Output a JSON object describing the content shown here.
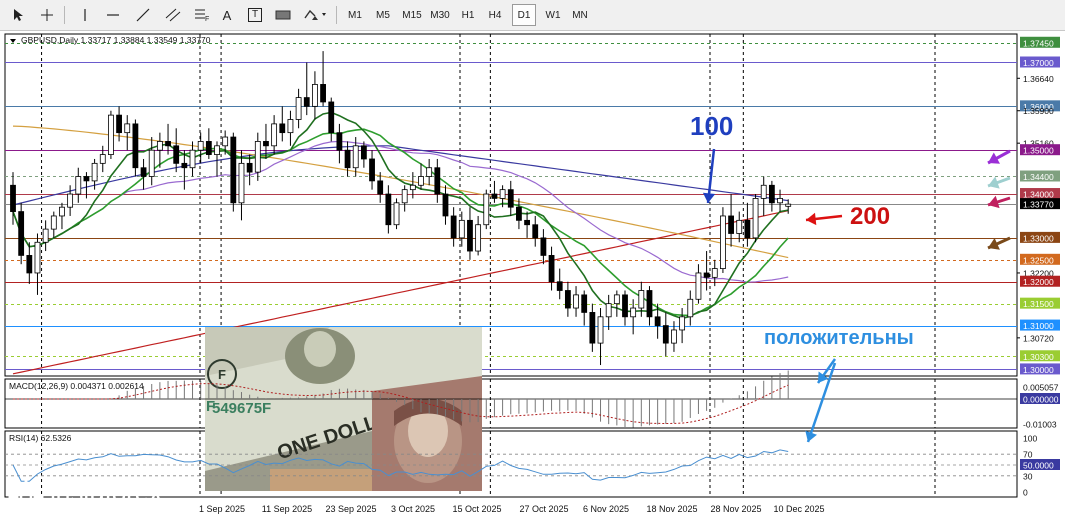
{
  "toolbar": {
    "timeframes": [
      "M1",
      "M5",
      "M15",
      "M30",
      "H1",
      "H4",
      "D1",
      "W1",
      "MN"
    ],
    "active_timeframe": "D1",
    "text_tool": "A",
    "label_tool": "T"
  },
  "chart_data": {
    "type": "candlestick",
    "symbol_header": "GBPUSD,Daily",
    "ohlc_header": "1.33717 1.33884 1.33549 1.33770",
    "price_axis": {
      "labels": [
        "1.37450",
        "1.37000",
        "1.36640",
        "1.36000",
        "1.35900",
        "1.35160",
        "1.35000",
        "1.34400",
        "1.34000",
        "1.33770",
        "1.33000",
        "1.32500",
        "1.32200",
        "1.32000",
        "1.31500",
        "1.31000",
        "1.30720",
        "1.30300",
        "1.30000"
      ],
      "range": [
        1.2985,
        1.3765
      ]
    },
    "horizontal_levels": [
      {
        "price": 1.3745,
        "label": "1.37450",
        "color": "#3f8f3f",
        "dashed": true
      },
      {
        "price": 1.37,
        "label": "1.37000",
        "color": "#6a5acd",
        "dashed": false
      },
      {
        "price": 1.36,
        "label": "1.36000",
        "color": "#4a7aa8",
        "dashed": false
      },
      {
        "price": 1.35,
        "label": "1.35000",
        "color": "#8b1a8b",
        "dashed": false
      },
      {
        "price": 1.344,
        "label": "1.34400",
        "color": "#7fa07f",
        "dashed": true
      },
      {
        "price": 1.34,
        "label": "1.34000",
        "color": "#b03a4a",
        "dashed": false
      },
      {
        "price": 1.3377,
        "label": "1.33770",
        "color": "#888888",
        "dashed": false,
        "current": true
      },
      {
        "price": 1.33,
        "label": "1.33000",
        "color": "#8b4513",
        "dashed": false
      },
      {
        "price": 1.325,
        "label": "1.32500",
        "color": "#d2691e",
        "dashed": true
      },
      {
        "price": 1.32,
        "label": "1.32000",
        "color": "#b22222",
        "dashed": false
      },
      {
        "price": 1.315,
        "label": "1.31500",
        "color": "#9acd32",
        "dashed": true
      },
      {
        "price": 1.31,
        "label": "1.31000",
        "color": "#1e90ff",
        "dashed": false
      },
      {
        "price": 1.303,
        "label": "1.30300",
        "color": "#9acd32",
        "dashed": true
      },
      {
        "price": 1.3,
        "label": "1.30000",
        "color": "#6a5acd",
        "dashed": false
      }
    ],
    "x_axis_labels": [
      "1 Sep 2025",
      "11 Sep 2025",
      "23 Sep 2025",
      "3 Oct 2025",
      "15 Oct 2025",
      "27 Oct 2025",
      "6 Nov 2025",
      "18 Nov 2025",
      "28 Nov 2025",
      "10 Dec 2025"
    ],
    "candles": [
      [
        1.342,
        1.345,
        1.333,
        1.336
      ],
      [
        1.336,
        1.338,
        1.324,
        1.326
      ],
      [
        1.326,
        1.329,
        1.3195,
        1.322
      ],
      [
        1.322,
        1.331,
        1.317,
        1.329
      ],
      [
        1.329,
        1.334,
        1.327,
        1.332
      ],
      [
        1.332,
        1.336,
        1.33,
        1.335
      ],
      [
        1.335,
        1.338,
        1.332,
        1.337
      ],
      [
        1.337,
        1.342,
        1.335,
        1.34
      ],
      [
        1.34,
        1.346,
        1.338,
        1.344
      ],
      [
        1.344,
        1.345,
        1.339,
        1.343
      ],
      [
        1.343,
        1.348,
        1.341,
        1.347
      ],
      [
        1.347,
        1.351,
        1.345,
        1.349
      ],
      [
        1.349,
        1.359,
        1.348,
        1.358
      ],
      [
        1.358,
        1.36,
        1.352,
        1.354
      ],
      [
        1.354,
        1.358,
        1.35,
        1.356
      ],
      [
        1.356,
        1.357,
        1.344,
        1.346
      ],
      [
        1.346,
        1.348,
        1.341,
        1.344
      ],
      [
        1.344,
        1.353,
        1.342,
        1.35
      ],
      [
        1.35,
        1.354,
        1.346,
        1.352
      ],
      [
        1.352,
        1.356,
        1.349,
        1.351
      ],
      [
        1.351,
        1.355,
        1.345,
        1.347
      ],
      [
        1.347,
        1.35,
        1.341,
        1.346
      ],
      [
        1.346,
        1.352,
        1.344,
        1.35
      ],
      [
        1.35,
        1.354,
        1.347,
        1.352
      ],
      [
        1.352,
        1.355,
        1.348,
        1.349
      ],
      [
        1.349,
        1.352,
        1.344,
        1.351
      ],
      [
        1.351,
        1.3545,
        1.349,
        1.353
      ],
      [
        1.353,
        1.354,
        1.336,
        1.338
      ],
      [
        1.338,
        1.35,
        1.334,
        1.347
      ],
      [
        1.347,
        1.349,
        1.342,
        1.345
      ],
      [
        1.345,
        1.354,
        1.343,
        1.352
      ],
      [
        1.352,
        1.356,
        1.348,
        1.351
      ],
      [
        1.351,
        1.358,
        1.349,
        1.356
      ],
      [
        1.356,
        1.36,
        1.352,
        1.354
      ],
      [
        1.354,
        1.359,
        1.351,
        1.357
      ],
      [
        1.357,
        1.364,
        1.355,
        1.362
      ],
      [
        1.362,
        1.37,
        1.358,
        1.36
      ],
      [
        1.36,
        1.368,
        1.357,
        1.365
      ],
      [
        1.365,
        1.3726,
        1.36,
        1.361
      ],
      [
        1.361,
        1.362,
        1.352,
        1.354
      ],
      [
        1.354,
        1.356,
        1.347,
        1.35
      ],
      [
        1.35,
        1.352,
        1.344,
        1.346
      ],
      [
        1.346,
        1.353,
        1.344,
        1.351
      ],
      [
        1.351,
        1.352,
        1.346,
        1.348
      ],
      [
        1.348,
        1.35,
        1.341,
        1.343
      ],
      [
        1.343,
        1.345,
        1.338,
        1.34
      ],
      [
        1.34,
        1.342,
        1.331,
        1.333
      ],
      [
        1.333,
        1.339,
        1.332,
        1.338
      ],
      [
        1.338,
        1.342,
        1.336,
        1.341
      ],
      [
        1.341,
        1.345,
        1.339,
        1.342
      ],
      [
        1.342,
        1.347,
        1.341,
        1.344
      ],
      [
        1.344,
        1.348,
        1.342,
        1.346
      ],
      [
        1.346,
        1.348,
        1.338,
        1.34
      ],
      [
        1.34,
        1.342,
        1.333,
        1.335
      ],
      [
        1.335,
        1.337,
        1.328,
        1.33
      ],
      [
        1.33,
        1.336,
        1.328,
        1.334
      ],
      [
        1.334,
        1.337,
        1.325,
        1.327
      ],
      [
        1.327,
        1.335,
        1.326,
        1.333
      ],
      [
        1.333,
        1.341,
        1.332,
        1.34
      ],
      [
        1.34,
        1.343,
        1.338,
        1.339
      ],
      [
        1.339,
        1.342,
        1.337,
        1.341
      ],
      [
        1.341,
        1.343,
        1.335,
        1.337
      ],
      [
        1.337,
        1.339,
        1.332,
        1.334
      ],
      [
        1.334,
        1.336,
        1.33,
        1.333
      ],
      [
        1.333,
        1.335,
        1.328,
        1.33
      ],
      [
        1.33,
        1.332,
        1.324,
        1.326
      ],
      [
        1.326,
        1.328,
        1.318,
        1.32
      ],
      [
        1.32,
        1.323,
        1.316,
        1.318
      ],
      [
        1.318,
        1.32,
        1.312,
        1.314
      ],
      [
        1.314,
        1.319,
        1.312,
        1.317
      ],
      [
        1.317,
        1.318,
        1.31,
        1.313
      ],
      [
        1.313,
        1.315,
        1.304,
        1.306
      ],
      [
        1.306,
        1.314,
        1.301,
        1.312
      ],
      [
        1.312,
        1.317,
        1.309,
        1.315
      ],
      [
        1.315,
        1.318,
        1.312,
        1.317
      ],
      [
        1.317,
        1.318,
        1.31,
        1.312
      ],
      [
        1.312,
        1.316,
        1.308,
        1.314
      ],
      [
        1.314,
        1.32,
        1.312,
        1.318
      ],
      [
        1.318,
        1.319,
        1.31,
        1.312
      ],
      [
        1.312,
        1.315,
        1.307,
        1.31
      ],
      [
        1.31,
        1.313,
        1.303,
        1.306
      ],
      [
        1.306,
        1.311,
        1.304,
        1.309
      ],
      [
        1.309,
        1.314,
        1.306,
        1.312
      ],
      [
        1.312,
        1.318,
        1.31,
        1.316
      ],
      [
        1.316,
        1.324,
        1.315,
        1.322
      ],
      [
        1.322,
        1.327,
        1.318,
        1.321
      ],
      [
        1.321,
        1.325,
        1.319,
        1.323
      ],
      [
        1.323,
        1.337,
        1.322,
        1.335
      ],
      [
        1.335,
        1.34,
        1.328,
        1.331
      ],
      [
        1.331,
        1.336,
        1.329,
        1.334
      ],
      [
        1.334,
        1.338,
        1.328,
        1.33
      ],
      [
        1.33,
        1.34,
        1.329,
        1.339
      ],
      [
        1.339,
        1.344,
        1.335,
        1.342
      ],
      [
        1.342,
        1.343,
        1.336,
        1.338
      ],
      [
        1.338,
        1.341,
        1.336,
        1.339
      ],
      [
        1.3372,
        1.3388,
        1.3355,
        1.3377
      ]
    ],
    "moving_averages": [
      {
        "period": 100,
        "color": "#3a3aa0"
      },
      {
        "period": 200,
        "color": "#c02020"
      },
      {
        "period": 50,
        "color": "#d4a040"
      },
      {
        "period": 30,
        "color": "#9a6ad0"
      },
      {
        "period": 14,
        "color": "#2e9e2e"
      },
      {
        "period": 8,
        "color": "#207020"
      }
    ],
    "indicators": {
      "macd": {
        "label": "MACD(12,26,9) 0.004371 0.002614",
        "axis_labels": [
          "0.005057",
          "0.000000",
          "-0.01003"
        ]
      },
      "rsi": {
        "label": "RSI(14) 62.5326",
        "axis_labels": [
          "100",
          "70",
          "50.0000",
          "30",
          "0"
        ],
        "levels": [
          70,
          50,
          30
        ]
      }
    },
    "annotations": [
      {
        "text": "100",
        "color": "#1f3fbf"
      },
      {
        "text": "200",
        "color": "#cc1111"
      },
      {
        "text": "положительны",
        "color": "#2e8fe0"
      }
    ],
    "arrow_colors": {
      "purple": "#9b2fd6",
      "light_blue": "#9ecfcf",
      "magenta": "#c0205f",
      "brown": "#7a4a1a",
      "blue": "#1f3fbf",
      "red": "#dd1111",
      "sky": "#2e8fe0"
    }
  },
  "colors": {
    "bull_candle": "#ffffff",
    "bear_candle": "#000000",
    "grid": "#000000",
    "rsi_line": "#4a8fd0",
    "macd_signal": "#b02020",
    "macd_hist": "#777777"
  },
  "logo": {
    "name": "instaforex",
    "tagline": "Instant Forex Trading"
  }
}
